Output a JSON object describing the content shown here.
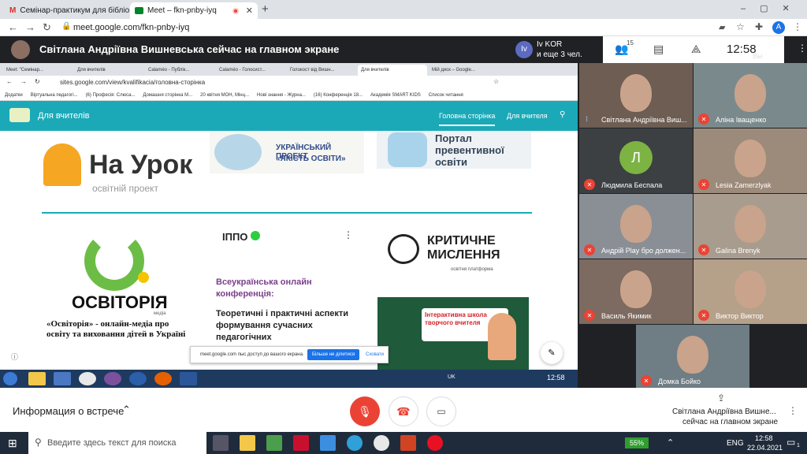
{
  "browser": {
    "tabs": [
      {
        "label": "Семінар-практикум для бібліот",
        "icon": "gmail-icon"
      },
      {
        "label": "Meet – fkn-pnby-iyq",
        "icon": "meet-icon"
      }
    ],
    "url": "meet.google.com/fkn-pnby-iyq",
    "profile_letter": "A"
  },
  "meet": {
    "presenting_banner": "Світлана Андріївна Вишневська сейчас на главном экране",
    "host_initials": "Iv",
    "host_name": "Iv KOR",
    "host_sub": "и еще 3 чел.",
    "people_count": "15",
    "clock": "12:58",
    "you_label": "Вы",
    "meeting_info": "Информация о встрече",
    "presenter_line1": "Світлана Андріївна Вишне...",
    "presenter_line2": "сейчас на главном экране"
  },
  "participants": [
    {
      "name": "Світлана Андріївна Виш...",
      "muted": false
    },
    {
      "name": "Аліна Іващенко",
      "muted": true
    },
    {
      "name": "Людмила Беспала",
      "muted": true,
      "initial": "Л",
      "avatar_color": "#7cb342"
    },
    {
      "name": "Lesia Zamerzlyak",
      "muted": true
    },
    {
      "name": "Андрій Play бро должен...",
      "muted": true
    },
    {
      "name": "Galina Brenyk",
      "muted": true
    },
    {
      "name": "Василь Якимик",
      "muted": true
    },
    {
      "name": "Виктор Виктор",
      "muted": true
    },
    {
      "name": "Домка Бойко",
      "muted": true
    }
  ],
  "shared": {
    "tabs": [
      "Meet: \"Семінар...",
      "Для вчителів",
      "Calaméo - Публік...",
      "Calaméo - Голосист...",
      "Голокост від Вишн...",
      "Для вчителів",
      "Мій диск – Google..."
    ],
    "url": "sites.google.com/view/kvalifikacia/головна-сторінка",
    "bookmarks": [
      "Додатки",
      "Віртуальна педагогі...",
      "(6) Професія: Слюса...",
      "Домашня сторінка М...",
      "20 квітня МОН, Мінц...",
      "Нові знання - Журна...",
      "(16) Конференція 18...",
      "Академія SMART KIDS",
      "Список читання"
    ],
    "site_title": "Для вчителів",
    "nav": [
      "Головна сторінка",
      "Для вчителя"
    ],
    "naurok_title": "На Урок",
    "naurok_sub": "освітній проект",
    "yakist_line1": "УКРАЇНСЬКИЙ ПРОЕКТ",
    "yakist_line2": "«ЯКІСТЬ ОСВІТИ»",
    "portal_line1": "Портал",
    "portal_line2": "превентивної",
    "portal_line3": "освіти",
    "osvitoria_logo": "ОСВІТОРІЯ",
    "osvitoria_small": "медіа",
    "osvitoria_desc": "«Освіторія» - онлайн-медіа про освіту та виховання дітей в Україні",
    "ippo": "ІППО",
    "conf_title": "Всеукраїнська онлайн конференція:",
    "conf_body": "Теоретичні і практичні аспекти формування сучасних педагогічних",
    "krytychne1": "КРИТИЧНЕ",
    "krytychne2": "МИСЛЕННЯ",
    "krytychne_sub": "освітня платформа",
    "school_text": "Інтерактивна школа творчого вчителя",
    "share_notice": "meet.google.com пыс доступ до вашого екрана.",
    "share_stop": "Більше не ділитися",
    "share_hide": "Сховати",
    "inner_lang": "UK",
    "inner_time": "12:58"
  },
  "taskbar": {
    "search_placeholder": "Введите здесь текст для поиска",
    "battery": "55%",
    "lang": "ENG",
    "time": "12:58",
    "date": "22.04.2021",
    "notif_count": "1"
  }
}
